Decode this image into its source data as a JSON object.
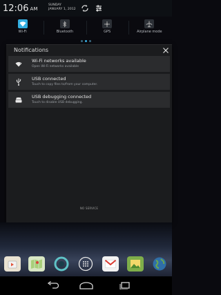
{
  "status": {
    "time": "12:06",
    "ampm": "AM",
    "day": "SUNDAY",
    "date": "JANUARY 1, 2012"
  },
  "toggles": [
    {
      "label": "Wi-Fi",
      "icon": "wifi-icon",
      "active": true
    },
    {
      "label": "Bluetooth",
      "icon": "bluetooth-icon",
      "active": false
    },
    {
      "label": "GPS",
      "icon": "gps-icon",
      "active": false
    },
    {
      "label": "Airplane mode",
      "icon": "airplane-icon",
      "active": false
    }
  ],
  "notifications_panel": {
    "title": "Notifications",
    "items": [
      {
        "title": "Wi-Fi networks available",
        "subtitle": "Open Wi-Fi networks available",
        "icon": "wifi-icon"
      },
      {
        "title": "USB connected",
        "subtitle": "Touch to copy files to/from your computer.",
        "icon": "usb-icon"
      },
      {
        "title": "USB debugging connected",
        "subtitle": "Touch to disable USB debugging.",
        "icon": "android-debug-icon"
      }
    ],
    "carrier_status": "NO SERVICE"
  },
  "dock_apps": [
    {
      "name": "play-store-icon"
    },
    {
      "name": "maps-icon"
    },
    {
      "name": "browser-icon"
    },
    {
      "name": "all-apps-icon"
    },
    {
      "name": "gmail-icon"
    },
    {
      "name": "gallery-icon"
    },
    {
      "name": "earth-icon"
    }
  ],
  "colors": {
    "accent": "#33aee0",
    "panel_bg": "#1b1c1e",
    "notification_bg": "#2b2c2e"
  }
}
